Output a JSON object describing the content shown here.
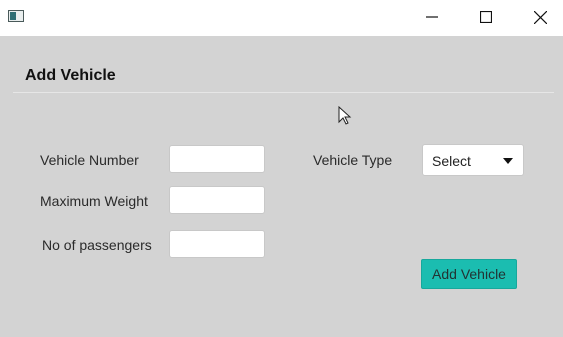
{
  "window": {
    "minimize_icon": "minimize-icon",
    "maximize_icon": "maximize-icon",
    "close_icon": "close-icon"
  },
  "form": {
    "title": "Add Vehicle",
    "vehicle_number": {
      "label": "Vehicle Number",
      "value": ""
    },
    "maximum_weight": {
      "label": "Maximum Weight",
      "value": ""
    },
    "passengers": {
      "label": "No of passengers",
      "value": ""
    },
    "vehicle_type": {
      "label": "Vehicle Type",
      "selected": "Select"
    },
    "submit_label": "Add Vehicle"
  },
  "colors": {
    "background": "#d3d3d3",
    "accent": "#1bbdb0"
  }
}
